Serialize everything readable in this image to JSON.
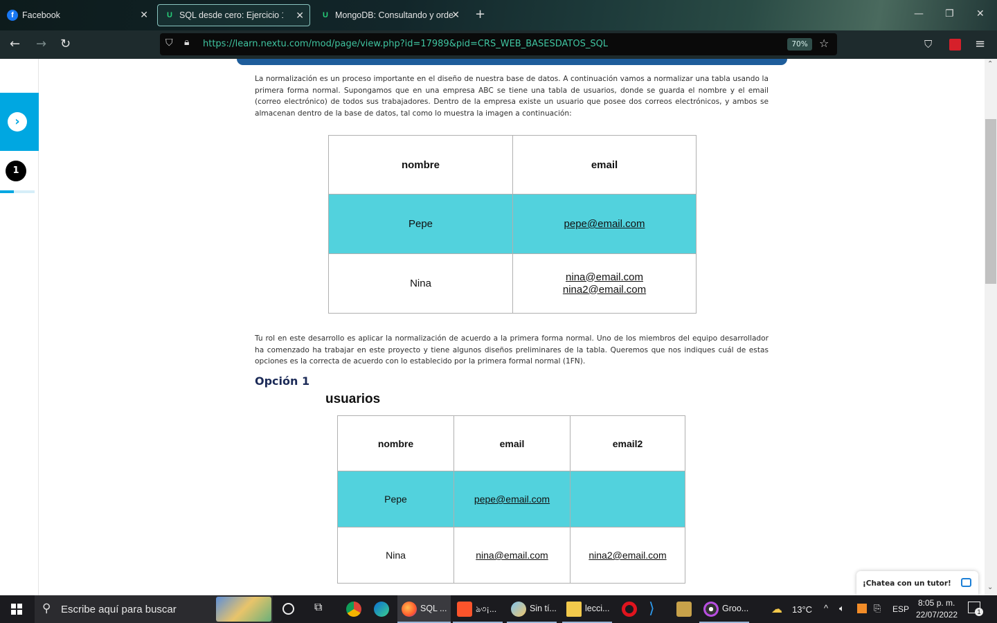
{
  "browser": {
    "tabs": [
      {
        "title": "Facebook",
        "favicon": "facebook-icon"
      },
      {
        "title": "SQL desde cero: Ejercicio 1",
        "favicon": "nextu-icon",
        "active": true
      },
      {
        "title": "MongoDB: Consultando y orde",
        "favicon": "nextu-icon"
      }
    ],
    "url": "https://learn.nextu.com/mod/page/view.php?id=17989&pid=CRS_WEB_BASESDATOS_SQL",
    "zoom": "70%"
  },
  "sidebar": {
    "step": "1",
    "progress_fraction": 0.4
  },
  "page": {
    "intro": "La normalización es un proceso importante en el diseño de nuestra base de datos. A continuación vamos a normalizar una tabla usando la primera forma normal. Supongamos que en una empresa ABC se tiene una tabla de usuarios, donde se guarda el nombre y el email (correo electrónico) de todos sus trabajadores. Dentro de la empresa existe un usuario que posee dos correos electrónicos, y ambos se almacenan dentro de la base de datos, tal como lo muestra la imagen a continuación:",
    "table1": {
      "headers": [
        "nombre",
        "email"
      ],
      "rows": [
        {
          "nombre": "Pepe",
          "email1": "pepe@email.com",
          "email2": ""
        },
        {
          "nombre": "Nina",
          "email1": "nina@email.com",
          "email2": "nina2@email.com"
        }
      ]
    },
    "role_text": "Tu rol en este desarrollo es aplicar la normalización de acuerdo a la primera forma normal. Uno de los miembros del equipo desarrollador ha comenzado ha trabajar en este proyecto y tiene algunos diseños preliminares de la tabla. Queremos que nos indiques cuál de estas opciones es la correcta de acuerdo con lo establecido por la primera formal normal (1FN).",
    "option1": {
      "heading": "Opción 1",
      "table_title": "usuarios",
      "headers": [
        "nombre",
        "email",
        "email2"
      ],
      "rows": [
        [
          "Pepe",
          "pepe@email.com",
          ""
        ],
        [
          "Nina",
          "nina@email.com",
          "nina2@email.com"
        ]
      ]
    },
    "chat_label": "¡Chatea con un tutor!"
  },
  "taskbar": {
    "search_placeholder": "Escribe aquí para buscar",
    "apps": [
      {
        "label": "SQL ...",
        "icon": "firefox-icon"
      },
      {
        "label": "ঌ৩¡...",
        "icon": "brave-icon"
      },
      {
        "label": "Sin tí...",
        "icon": "paint-icon"
      },
      {
        "label": "lecci...",
        "icon": "folder-icon"
      },
      {
        "label": "Groo...",
        "icon": "groove-icon"
      }
    ],
    "temperature": "13°C",
    "language": "ESP",
    "time": "8:05 p. m.",
    "date": "22/07/2022",
    "notifications": "1"
  }
}
